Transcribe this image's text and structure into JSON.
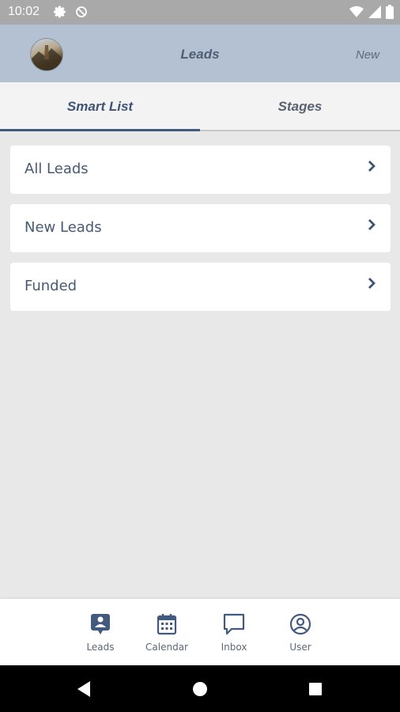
{
  "status_bar": {
    "time": "10:02"
  },
  "app_bar": {
    "title": "Leads",
    "new_label": "New"
  },
  "tabs": [
    {
      "label": "Smart List",
      "active": true
    },
    {
      "label": "Stages",
      "active": false
    }
  ],
  "smart_list": [
    {
      "label": "All Leads"
    },
    {
      "label": "New Leads"
    },
    {
      "label": "Funded"
    }
  ],
  "bottom_nav": [
    {
      "label": "Leads",
      "icon": "leads-icon"
    },
    {
      "label": "Calendar",
      "icon": "calendar-icon"
    },
    {
      "label": "Inbox",
      "icon": "inbox-icon"
    },
    {
      "label": "User",
      "icon": "user-icon"
    }
  ],
  "colors": {
    "app_bar_bg": "#b3c1d3",
    "accent": "#415a7d",
    "background": "#e8e8e8",
    "text": "#465a75"
  }
}
